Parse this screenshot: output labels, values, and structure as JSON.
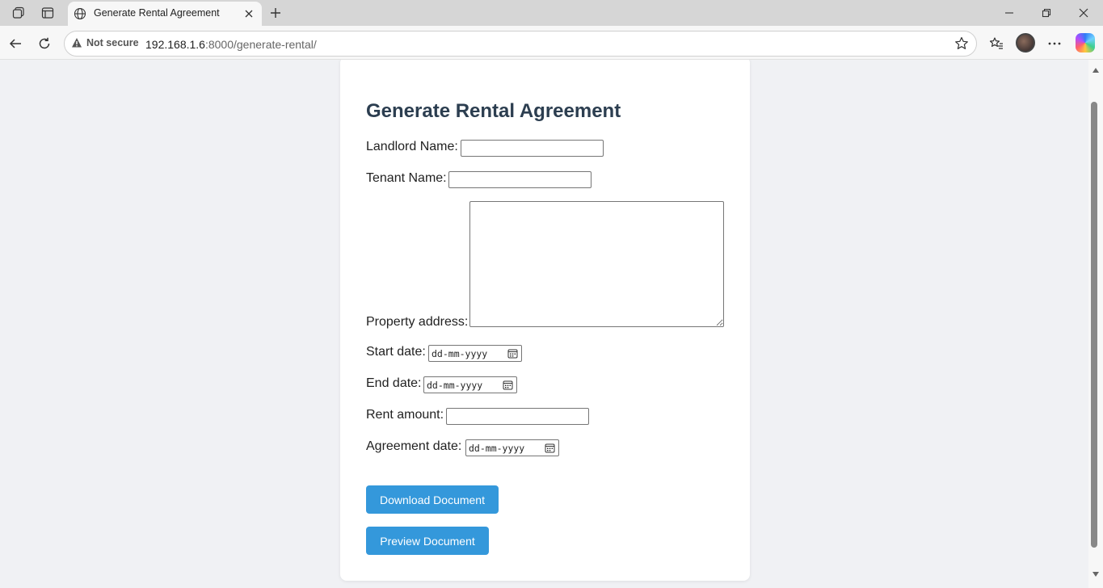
{
  "browser": {
    "tab_title": "Generate Rental Agreement",
    "security_label": "Not secure",
    "url_host": "192.168.1.6",
    "url_rest": ":8000/generate-rental/"
  },
  "page": {
    "heading": "Generate Rental Agreement",
    "fields": {
      "landlord_label": "Landlord Name:",
      "tenant_label": "Tenant Name:",
      "address_label": "Property address:",
      "start_label": "Start date:",
      "end_label": "End date:",
      "rent_label": "Rent amount:",
      "agreement_label": "Agreement date:",
      "date_placeholder": "dd-mm-yyyy"
    },
    "buttons": {
      "download": "Download Document",
      "preview": "Preview Document"
    }
  },
  "colors": {
    "primary_button": "#3498db",
    "heading": "#2c3e50"
  }
}
